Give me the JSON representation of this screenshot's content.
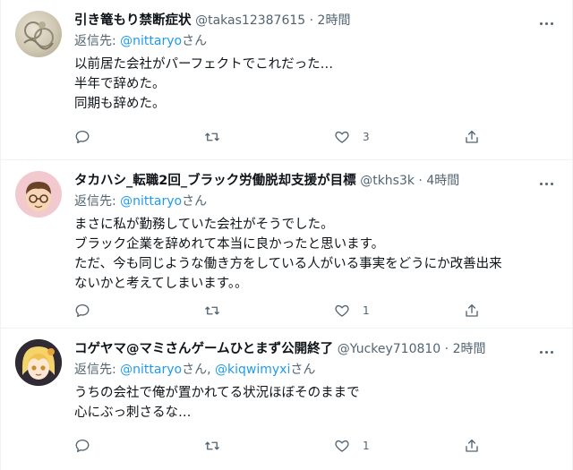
{
  "replying_label": "返信先: ",
  "replying_suffix": "さん",
  "tweets": [
    {
      "name": "引き篭もり禁断症状",
      "handle": "@takas12387615",
      "time": "2時間",
      "reply_to": [
        "@nittaryo"
      ],
      "lines": [
        "以前居た会社がパーフェクトでこれだった…",
        "半年で辞めた。",
        "同期も辞めた。"
      ],
      "likes": "3"
    },
    {
      "name": "タカハシ_転職2回_ブラック労働脱却支援が目標",
      "handle": "@tkhs3k",
      "time": "4時間",
      "reply_to": [
        "@nittaryo"
      ],
      "lines": [
        "まさに私が勤務していた会社がそうでした。",
        "ブラック企業を辞めれて本当に良かったと思います。",
        "ただ、今も同じような働き方をしている人がいる事実をどうにか改善出来",
        "ないかと考えてしまいます。。"
      ],
      "likes": "1"
    },
    {
      "name": "コゲヤマ@マミさんゲームひとまず公開終了",
      "handle": "@Yuckey710810",
      "time": "2時間",
      "reply_to": [
        "@nittaryo",
        "@kiqwimyxi"
      ],
      "reply_sep": "さん, ",
      "lines": [
        "うちの会社で俺が置かれてる状況ほぼそのままで",
        "心にぶっ刺さるな…"
      ],
      "likes": "1"
    }
  ],
  "colors": {
    "accent": "#1d9bf0",
    "secondary_text": "#536471",
    "divider": "#eff3f4"
  },
  "icons": {
    "reply": "reply-icon",
    "retweet": "retweet-icon",
    "like": "heart-icon",
    "share": "share-icon",
    "more": "more-icon"
  }
}
